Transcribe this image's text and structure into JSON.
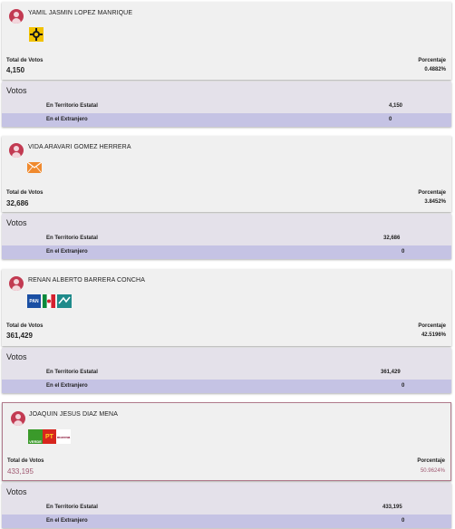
{
  "labels": {
    "total_votos": "Total de Votos",
    "porcentaje": "Porcentaje",
    "votos": "Votos",
    "territorio": "En Territorio Estatal",
    "extranjero": "En el Extranjero"
  },
  "candidates": [
    {
      "name": "YAMIL JASMIN LOPEZ MANRIQUE",
      "total": "4,150",
      "percent": "0.4882%",
      "territorio": "4,150",
      "extranjero": "0",
      "party_logos": [
        "party-logo-icon"
      ]
    },
    {
      "name": "VIDA ARAVARI GOMEZ HERRERA",
      "total": "32,686",
      "percent": "3.8452%",
      "territorio": "32,686",
      "extranjero": "0",
      "party_logos": [
        "envelope-logo-icon"
      ]
    },
    {
      "name": "RENAN ALBERTO BARRERA CONCHA",
      "total": "361,429",
      "percent": "42.5196%",
      "territorio": "361,429",
      "extranjero": "0",
      "party_logos": [
        "pan-logo-icon",
        "pri-logo-icon",
        "coalition-logo-icon"
      ]
    },
    {
      "name": "JOAQUIN JESUS DIAZ MENA",
      "total": "433,195",
      "percent": "50.9624%",
      "territorio": "433,195",
      "extranjero": "0",
      "party_logos": [
        "pvem-logo-icon",
        "pt-logo-icon",
        "morena-logo-icon"
      ]
    }
  ],
  "logo_text": {
    "pan": "PAN",
    "pvem": "VERDE",
    "pt": "PT",
    "morena": "morena"
  }
}
